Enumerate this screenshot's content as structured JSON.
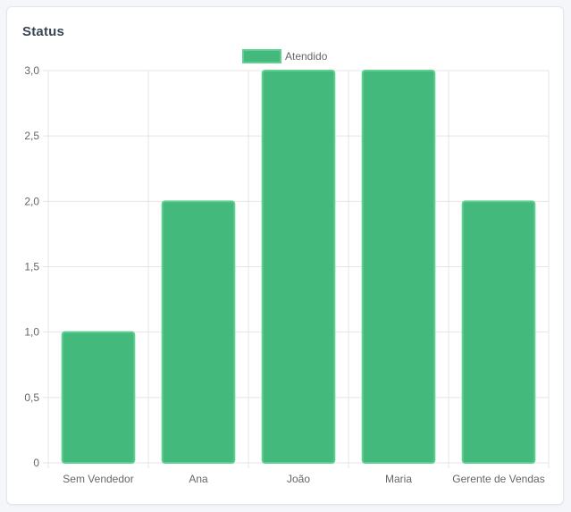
{
  "card": {
    "title": "Status"
  },
  "colors": {
    "bar_fill": "#43b97b",
    "bar_border": "#5fcf92",
    "grid": "#e5e5e5"
  },
  "chart_data": {
    "type": "bar",
    "title": "",
    "xlabel": "",
    "ylabel": "",
    "categories": [
      "Sem Vendedor",
      "Ana",
      "João",
      "Maria",
      "Gerente de Vendas"
    ],
    "series": [
      {
        "name": "Atendido",
        "values": [
          1,
          2,
          3,
          3,
          2
        ]
      }
    ],
    "ylim": [
      0,
      3
    ],
    "y_ticks": [
      "0",
      "0,5",
      "1,0",
      "1,5",
      "2,0",
      "2,5",
      "3,0"
    ],
    "grid": true,
    "legend_position": "top-center"
  }
}
